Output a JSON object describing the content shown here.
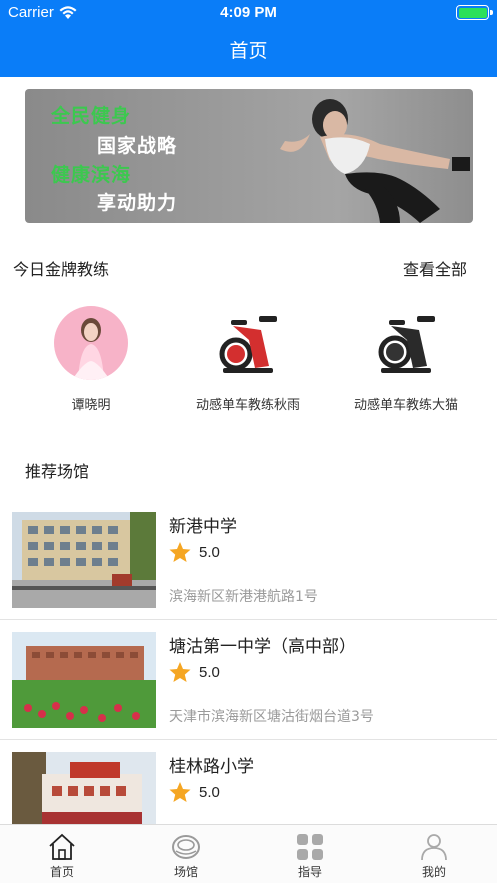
{
  "status": {
    "carrier": "Carrier",
    "time": "4:09 PM"
  },
  "nav": {
    "title": "首页"
  },
  "banner": {
    "line1": "全民健身",
    "line2": "国家战略",
    "line3": "健康滨海",
    "line4": "享动助力"
  },
  "coaches": {
    "title": "今日金牌教练",
    "view_all": "查看全部",
    "items": [
      {
        "name": "谭晓明"
      },
      {
        "name": "动感单车教练秋雨"
      },
      {
        "name": "动感单车教练大猫"
      }
    ]
  },
  "recommend": {
    "title": "推荐场馆",
    "venues": [
      {
        "name": "新港中学",
        "rating": "5.0",
        "address": "滨海新区新港港航路1号"
      },
      {
        "name": "塘沽第一中学（高中部）",
        "rating": "5.0",
        "address": "天津市滨海新区塘沽街烟台道3号"
      },
      {
        "name": "桂林路小学",
        "rating": "5.0",
        "address": ""
      }
    ]
  },
  "tabs": [
    {
      "label": "首页",
      "icon": "home-icon"
    },
    {
      "label": "场馆",
      "icon": "venue-icon"
    },
    {
      "label": "指导",
      "icon": "guide-icon"
    },
    {
      "label": "我的",
      "icon": "profile-icon"
    }
  ],
  "colors": {
    "primary": "#0a7df8",
    "star": "#f5a623",
    "banner_green": "#3cc84f"
  }
}
